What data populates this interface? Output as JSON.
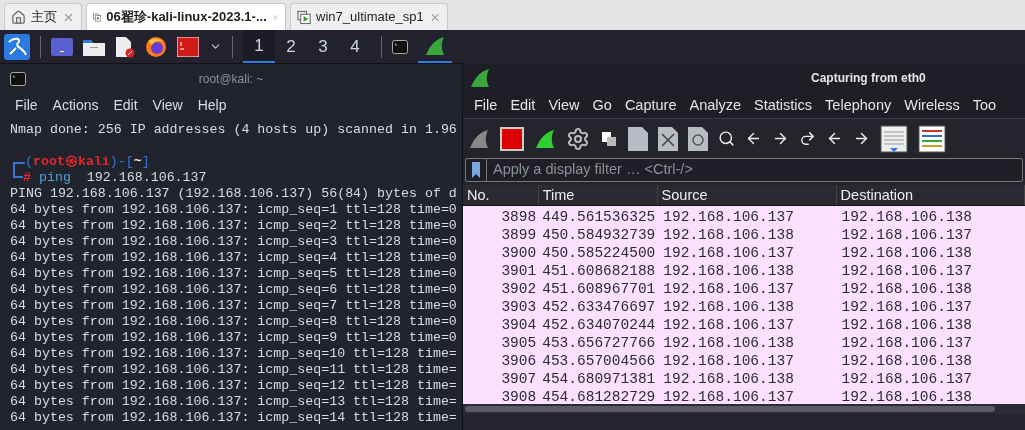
{
  "browser_tabs": [
    {
      "label": "主页",
      "kind": "home",
      "selected": false
    },
    {
      "label": "06翟珍-kali-linux-2023.1-...",
      "kind": "vm",
      "selected": true
    },
    {
      "label": "win7_ultimate_sp1",
      "kind": "vm",
      "selected": false
    }
  ],
  "workspaces": [
    {
      "label": "1",
      "selected": true
    },
    {
      "label": "2",
      "selected": false
    },
    {
      "label": "3",
      "selected": false
    },
    {
      "label": "4",
      "selected": false
    }
  ],
  "terminal": {
    "title": "root@kali: ~",
    "menu": [
      "File",
      "Actions",
      "Edit",
      "View",
      "Help"
    ],
    "lines": [
      {
        "kind": "out",
        "text": "Nmap done: 256 IP addresses (4 hosts up) scanned in 1.96"
      },
      {
        "kind": "blank"
      },
      {
        "kind": "prompt",
        "top": [
          {
            "kind": "bracket",
            "text": "("
          },
          {
            "kind": "user",
            "text": "root㉿kali"
          },
          {
            "kind": "bracket",
            "text": ")-["
          },
          {
            "kind": "dir",
            "text": "~"
          },
          {
            "kind": "bracket",
            "text": "]"
          }
        ],
        "bottom": [
          {
            "kind": "hash",
            "text": "#"
          },
          {
            "kind": "command",
            "text": "ping"
          },
          {
            "kind": "args",
            "text": "192.168.106.137"
          }
        ]
      },
      {
        "kind": "out",
        "text": "PING 192.168.106.137 (192.168.106.137) 56(84) bytes of d"
      },
      {
        "kind": "out",
        "text": "64 bytes from 192.168.106.137: icmp_seq=1 ttl=128 time=0"
      },
      {
        "kind": "out",
        "text": "64 bytes from 192.168.106.137: icmp_seq=2 ttl=128 time=0"
      },
      {
        "kind": "out",
        "text": "64 bytes from 192.168.106.137: icmp_seq=3 ttl=128 time=0"
      },
      {
        "kind": "out",
        "text": "64 bytes from 192.168.106.137: icmp_seq=4 ttl=128 time=0"
      },
      {
        "kind": "out",
        "text": "64 bytes from 192.168.106.137: icmp_seq=5 ttl=128 time=0"
      },
      {
        "kind": "out",
        "text": "64 bytes from 192.168.106.137: icmp_seq=6 ttl=128 time=0"
      },
      {
        "kind": "out",
        "text": "64 bytes from 192.168.106.137: icmp_seq=7 ttl=128 time=0"
      },
      {
        "kind": "out",
        "text": "64 bytes from 192.168.106.137: icmp_seq=8 ttl=128 time=0"
      },
      {
        "kind": "out",
        "text": "64 bytes from 192.168.106.137: icmp_seq=9 ttl=128 time=0"
      },
      {
        "kind": "out",
        "text": "64 bytes from 192.168.106.137: icmp_seq=10 ttl=128 time="
      },
      {
        "kind": "out",
        "text": "64 bytes from 192.168.106.137: icmp_seq=11 ttl=128 time="
      },
      {
        "kind": "out",
        "text": "64 bytes from 192.168.106.137: icmp_seq=12 ttl=128 time="
      },
      {
        "kind": "out",
        "text": "64 bytes from 192.168.106.137: icmp_seq=13 ttl=128 time="
      },
      {
        "kind": "out",
        "text": "64 bytes from 192.168.106.137: icmp_seq=14 ttl=128 time="
      }
    ]
  },
  "wireshark": {
    "title": "Capturing from eth0",
    "menu": [
      "File",
      "Edit",
      "View",
      "Go",
      "Capture",
      "Analyze",
      "Statistics",
      "Telephony",
      "Wireless",
      "Too"
    ],
    "filter": {
      "placeholder": "Apply a display filter … <Ctrl-/>"
    },
    "table": {
      "columns": [
        "No.",
        "Time",
        "Source",
        "Destination"
      ],
      "rows": [
        [
          "3898",
          "449.561536325",
          "192.168.106.137",
          "192.168.106.138"
        ],
        [
          "3899",
          "450.584932739",
          "192.168.106.138",
          "192.168.106.137"
        ],
        [
          "3900",
          "450.585224500",
          "192.168.106.137",
          "192.168.106.138"
        ],
        [
          "3901",
          "451.608682188",
          "192.168.106.138",
          "192.168.106.137"
        ],
        [
          "3902",
          "451.608967701",
          "192.168.106.137",
          "192.168.106.138"
        ],
        [
          "3903",
          "452.633476697",
          "192.168.106.138",
          "192.168.106.137"
        ],
        [
          "3904",
          "452.634070244",
          "192.168.106.137",
          "192.168.106.138"
        ],
        [
          "3905",
          "453.656727766",
          "192.168.106.138",
          "192.168.106.137"
        ],
        [
          "3906",
          "453.657004566",
          "192.168.106.137",
          "192.168.106.138"
        ],
        [
          "3907",
          "454.680971381",
          "192.168.106.138",
          "192.168.106.137"
        ],
        [
          "3908",
          "454.681282729",
          "192.168.106.137",
          "192.168.106.138"
        ]
      ]
    }
  }
}
